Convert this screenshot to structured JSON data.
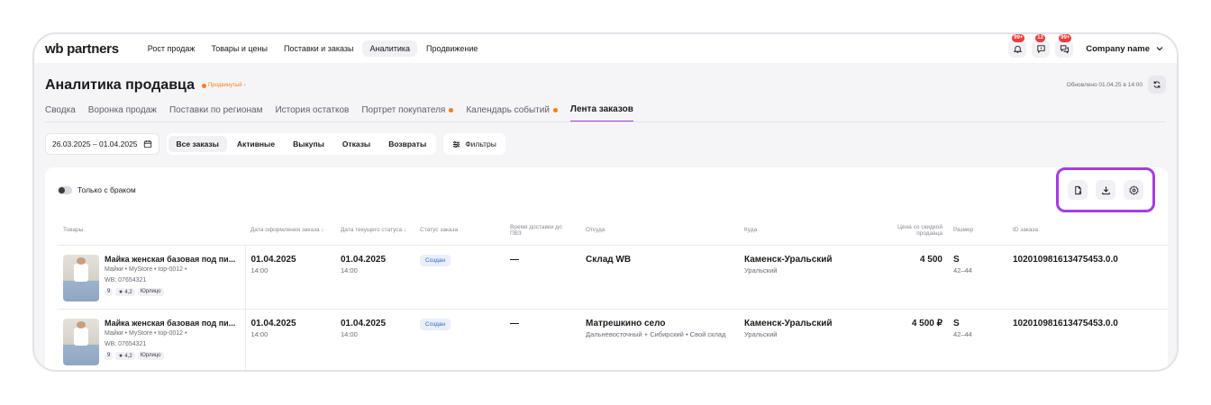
{
  "topbar": {
    "logo_wb": "wb",
    "logo_partners": "partners",
    "nav": [
      {
        "label": "Рост продаж",
        "active": false
      },
      {
        "label": "Товары и цены",
        "active": false
      },
      {
        "label": "Поставки и заказы",
        "active": false
      },
      {
        "label": "Аналитика",
        "active": true
      },
      {
        "label": "Продвижение",
        "active": false
      }
    ],
    "notif_badges": [
      "99+",
      "12",
      "99+"
    ],
    "company": "Company name"
  },
  "header": {
    "title": "Аналитика продавца",
    "promo": "Продвинутый",
    "updated": "Обновлено 01.04.25 в 14:00"
  },
  "tabs": [
    {
      "label": "Сводка"
    },
    {
      "label": "Воронка продаж"
    },
    {
      "label": "Поставки по регионам"
    },
    {
      "label": "История остатков"
    },
    {
      "label": "Портрет покупателя"
    },
    {
      "label": "Календарь событий"
    },
    {
      "label": "Лента заказов"
    }
  ],
  "filters": {
    "date_range": "26.03.2025 – 01.04.2025",
    "segments": [
      "Все заказы",
      "Активные",
      "Выкупы",
      "Отказы",
      "Возвраты"
    ],
    "filter_button": "Фильтры"
  },
  "panel": {
    "toggle_label": "Только с браком"
  },
  "table": {
    "headers": {
      "product": "Товары",
      "order_date": "Дата оформления заказа",
      "status_date": "Дата текущего статуса",
      "status": "Статус заказа",
      "delivery_time": "Время доставки до ПВЗ",
      "from": "Откуда",
      "to": "Куда",
      "price": "Цена со скидкой продавца",
      "size": "Размер",
      "order_id": "ID заказа"
    },
    "rows": [
      {
        "name": "Майка женская базовая под пи...",
        "meta1": "Майки • MyStore • top-0012 •",
        "meta2": "WB: 07654321",
        "chip1": "9",
        "chip2": "4,2",
        "chip3": "Юрлицо",
        "order_date": "01.04.2025",
        "order_time": "14:00",
        "status_date": "01.04.2025",
        "status_time": "14:00",
        "status": "Создан",
        "delivery": "—",
        "from": "Склад WB",
        "from_sub": "",
        "to": "Каменск-Уральский",
        "to_sub": "Уральский",
        "price": "4 500",
        "size": "S",
        "size_range": "42–44",
        "order_id": "102010981613475453.0.0"
      },
      {
        "name": "Майка женская базовая под пи...",
        "meta1": "Майки • MyStore • top-0012 •",
        "meta2": "WB: 07654321",
        "chip1": "9",
        "chip2": "4,2",
        "chip3": "Юрлицо",
        "order_date": "01.04.2025",
        "order_time": "14:00",
        "status_date": "01.04.2025",
        "status_time": "14:00",
        "status": "Создан",
        "delivery": "—",
        "from": "Матрешкино село",
        "from_sub": "Дальневосточный + Сибирский • Свой склад",
        "to": "Каменск-Уральский",
        "to_sub": "Уральский",
        "price": "4 500 ₽",
        "size": "S",
        "size_range": "42–44",
        "order_id": "102010981613475453.0.0"
      }
    ]
  },
  "colors": {
    "accent": "#a33ddb",
    "highlight_border": "#a73be6",
    "badge": "#f03c3c",
    "promo": "#ff7a1a",
    "status_text": "#3565d6",
    "status_bg": "#e9effc"
  },
  "icons": [
    "bell-icon",
    "message-icon",
    "chat-icon",
    "chevron-down-icon",
    "refresh-icon",
    "calendar-icon",
    "filter-icon",
    "report-icon",
    "download-icon",
    "settings-icon",
    "star-icon"
  ]
}
